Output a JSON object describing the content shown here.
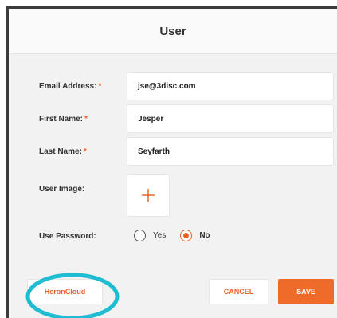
{
  "dialog": {
    "title": "User"
  },
  "fields": {
    "email": {
      "label": "Email Address:",
      "required": "*",
      "value": "jse@3disc.com"
    },
    "first_name": {
      "label": "First Name:",
      "required": "*",
      "value": "Jesper"
    },
    "last_name": {
      "label": "Last Name:",
      "required": "*",
      "value": "Seyfarth"
    },
    "user_image": {
      "label": "User Image:",
      "icon": "plus-icon"
    },
    "use_password": {
      "label": "Use Password:",
      "options": [
        {
          "label": "Yes",
          "selected": false
        },
        {
          "label": "No",
          "selected": true
        }
      ]
    }
  },
  "buttons": {
    "heroncloud": "HeronCloud",
    "cancel": "CANCEL",
    "save": "SAVE"
  },
  "colors": {
    "accent": "#e8632b",
    "save_bg": "#ef6b2a",
    "highlight": "#1fbcd2",
    "panel_bg": "#f2f2f2"
  }
}
